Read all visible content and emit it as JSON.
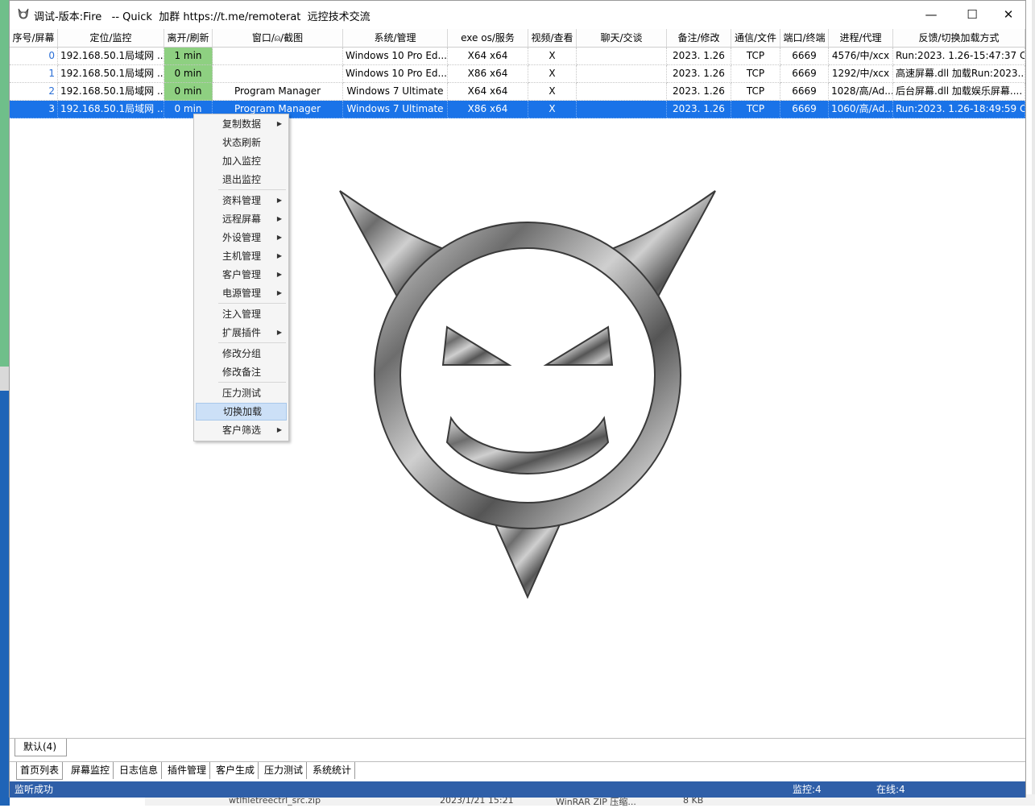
{
  "window": {
    "title": "调试-版本:Fire   -- Quick  加群 https://t.me/remoterat  远控技术交流",
    "controls": {
      "minimize": "—",
      "maximize": "☐",
      "close": "✕"
    }
  },
  "table": {
    "columns": [
      "序号/屏幕",
      "定位/监控",
      "离开/刷新",
      "窗口/⍝/截图",
      "系统/管理",
      "exe os/服务",
      "视频/查看",
      "聊天/交谈",
      "备注/修改",
      "通信/文件",
      "端口/终端",
      "进程/代理",
      "反馈/切换加载方式"
    ],
    "rows": [
      [
        "0",
        "192.168.50.1局域网 ...",
        "1 min",
        "",
        "Windows 10 Pro Ed...",
        "X64 x64",
        "X",
        "",
        "2023. 1.26",
        "TCP",
        "6669",
        "4576/中/xcx",
        "Run:2023. 1.26-15:47:37 C..."
      ],
      [
        "1",
        "192.168.50.1局域网 ...",
        "0 min",
        "",
        "Windows 10 Pro Ed...",
        "X86 x64",
        "X",
        "",
        "2023. 1.26",
        "TCP",
        "6669",
        "1292/中/xcx",
        "高速屏幕.dll 加载Run:2023...."
      ],
      [
        "2",
        "192.168.50.1局域网 ...",
        "0 min",
        "Program Manager",
        "Windows 7 Ultimate",
        "X64 x64",
        "X",
        "",
        "2023. 1.26",
        "TCP",
        "6669",
        "1028/高/Ad...",
        "后台屏幕.dll 加载娱乐屏幕...."
      ],
      [
        "3",
        "192.168.50.1局域网 ...",
        "0 min",
        "Program Manager",
        "Windows 7 Ultimate",
        "X86 x64",
        "X",
        "",
        "2023. 1.26",
        "TCP",
        "6669",
        "1060/高/Ad...",
        "Run:2023. 1.26-18:49:59 C..."
      ]
    ],
    "selected_row": 3
  },
  "context_menu": {
    "items": [
      {
        "label": "复制数据",
        "submenu": true
      },
      {
        "label": "状态刷新",
        "submenu": false
      },
      {
        "label": "加入监控",
        "submenu": false
      },
      {
        "label": "退出监控",
        "submenu": false
      },
      {
        "label": "资料管理",
        "submenu": true
      },
      {
        "label": "远程屏幕",
        "submenu": true
      },
      {
        "label": "外设管理",
        "submenu": true
      },
      {
        "label": "主机管理",
        "submenu": true
      },
      {
        "label": "客户管理",
        "submenu": true
      },
      {
        "label": "电源管理",
        "submenu": true
      },
      {
        "label": "注入管理",
        "submenu": false
      },
      {
        "label": "扩展插件",
        "submenu": true
      },
      {
        "label": "修改分组",
        "submenu": false
      },
      {
        "label": "修改备注",
        "submenu": false
      },
      {
        "label": "压力测试",
        "submenu": false
      },
      {
        "label": "切换加载",
        "submenu": false
      },
      {
        "label": "客户筛选",
        "submenu": true
      }
    ],
    "highlighted": "切换加载",
    "arrow": "▶"
  },
  "group_tabs": [
    "默认(4)"
  ],
  "page_tabs": [
    "首页列表",
    "屏幕监控",
    "日志信息",
    "插件管理",
    "客户生成",
    "压力测试",
    "系统统计"
  ],
  "active_page_tab": "首页列表",
  "status": {
    "left": "监听成功",
    "monitor": "监控:4",
    "online": "在线:4"
  },
  "desktop_behind": {
    "file": "wtlfiletreectrl_src.zip",
    "date": "2023/1/21 15:21",
    "type": "WinRAR ZIP 压缩...",
    "size": "8 KB"
  },
  "colors": {
    "selection": "#1a73e8",
    "green_cell": "#8ed081",
    "status_bar": "#2f5fa8",
    "menu_highlight": "#cce0f7"
  }
}
